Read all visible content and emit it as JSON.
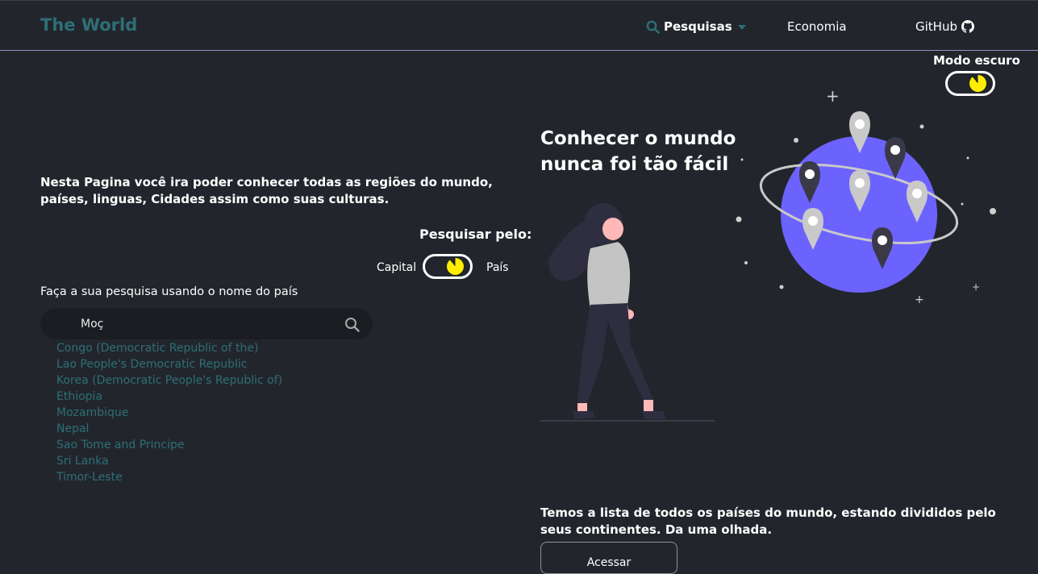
{
  "nav": {
    "brand": "The World",
    "pesquisas": "Pesquisas",
    "economia": "Economia",
    "github": "GitHub"
  },
  "dark_mode": {
    "label": "Modo escuro",
    "enabled": true
  },
  "intro_text": "Nesta Pagina você ira poder conhecer todas as regiões do mundo, países, linguas, Cidades assim como suas culturas.",
  "search_mode": {
    "title": "Pesquisar pelo:",
    "option_left": "Capital",
    "option_right": "País",
    "selected": "País"
  },
  "search": {
    "label": "Faça a sua pesquisa usando o nome do país",
    "value": "Moç",
    "results": [
      "Congo (Democratic Republic of the)",
      "Lao People's Democratic Republic",
      "Korea (Democratic People's Republic of)",
      "Ethiopia",
      "Mozambique",
      "Nepal",
      "Sao Tome and Principe",
      "Sri Lanka",
      "Timor-Leste"
    ]
  },
  "hero": {
    "headline": "Conhecer o mundo nunca foi tão fácil",
    "description": "Temos a lista de todos os países do mundo, estando divididos pelo seus continentes. Da uma olhada.",
    "button": "Acessar"
  },
  "colors": {
    "background": "#22262c",
    "accent": "#2e6e77",
    "globe": "#6c63ff",
    "toggle_knob": "#ffee00"
  },
  "icons": [
    "search-icon",
    "chevron-down-icon",
    "github-icon",
    "moon-icon"
  ]
}
